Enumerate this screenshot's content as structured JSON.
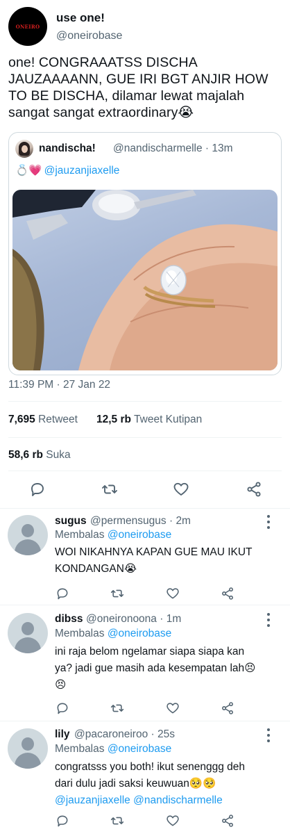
{
  "tweet": {
    "author": {
      "name": "use one!",
      "handle": "@oneirobase",
      "avatar_logo_text": "ONEIRO"
    },
    "text": "one! CONGRAAATSS DISCHA JAUZAAAANN, GUE IRI BGT ANJIR HOW TO BE DISCHA, dilamar lewat majalah sangat sangat extraordinary😭",
    "timestamp": "11:39 PM · 27 Jan 22",
    "stats": {
      "retweets": {
        "value": "7,695",
        "label": "Retweet"
      },
      "quotes": {
        "value": "12,5 rb",
        "label": "Tweet Kutipan"
      },
      "likes": {
        "value": "58,6 rb",
        "label": "Suka"
      }
    }
  },
  "quoted": {
    "name": "nandischa!",
    "handle": "@nandischarmelle",
    "time": "13m",
    "emoji": "💍💗",
    "mention": "@jauzanjiaxelle"
  },
  "actions": {
    "reply": "reply-icon",
    "retweet": "retweet-icon",
    "like": "heart-icon",
    "share": "share-icon"
  },
  "replies": [
    {
      "name": "sugus",
      "handle": "@permensugus",
      "time": "2m",
      "replying_label": "Membalas",
      "replying_to": "@oneirobase",
      "lines": [
        "WOI NIKAHNYA KAPAN GUE MAU IKUT",
        "KONDANGAN😭"
      ]
    },
    {
      "name": "dibss",
      "handle": "@oneironoona",
      "time": "1m",
      "replying_label": "Membalas",
      "replying_to": "@oneirobase",
      "lines": [
        "ini raja belom ngelamar siapa siapa kan",
        "ya? jadi gue masih ada kesempatan lah😣",
        "😣"
      ]
    },
    {
      "name": "lily",
      "handle": "@pacaroneiroo",
      "time": "25s",
      "replying_label": "Membalas",
      "replying_to": "@oneirobase",
      "lines": [
        "congratsss you both! ikut senenggg deh",
        "dari dulu jadi saksi keuwuan🥺🥺"
      ],
      "mentions": [
        "@jauzanjiaxelle",
        "@nandischarmelle"
      ]
    }
  ],
  "colors": {
    "accent": "#1d9bf0",
    "secondary_text": "#536471",
    "divider": "#eff3f4"
  }
}
